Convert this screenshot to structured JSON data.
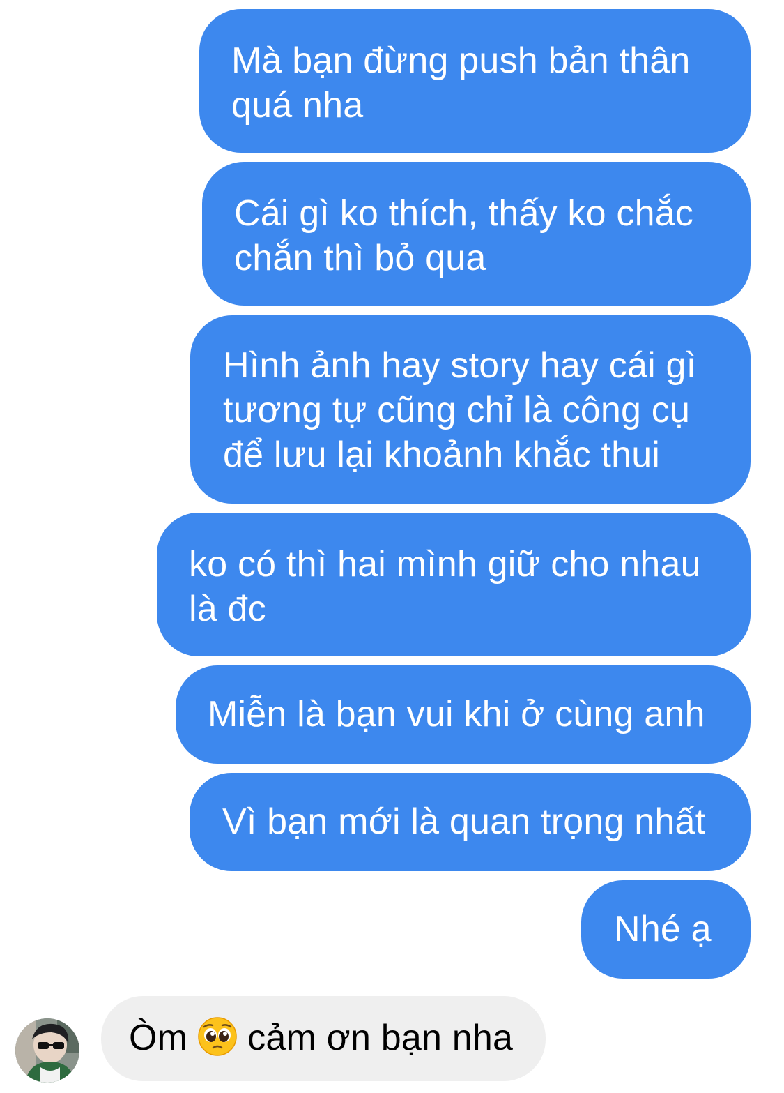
{
  "colors": {
    "outgoing_bubble": "#3d88ee",
    "incoming_bubble": "#efefef",
    "outgoing_text": "#ffffff",
    "incoming_text": "#000000"
  },
  "messages": [
    {
      "from": "me",
      "lines": [
        "Mà bạn đừng push bản thân",
        "quá nha"
      ]
    },
    {
      "from": "me",
      "lines": [
        "Cái gì ko thích, thấy ko chắc",
        "chắn thì bỏ qua"
      ]
    },
    {
      "from": "me",
      "lines": [
        "Hình ảnh hay story hay cái gì",
        "tương tự cũng chỉ là công cụ",
        "để lưu lại khoảnh khắc thui"
      ]
    },
    {
      "from": "me",
      "lines": [
        "ko có thì hai mình giữ cho nhau",
        "là đc"
      ]
    },
    {
      "from": "me",
      "lines": [
        "Miễn là bạn vui khi ở cùng anh"
      ]
    },
    {
      "from": "me",
      "lines": [
        "Vì bạn mới là quan trọng nhất"
      ]
    },
    {
      "from": "me",
      "lines": [
        "Nhé ạ"
      ]
    }
  ],
  "reply": {
    "from": "other",
    "text_before": "Òm",
    "emoji": "pleading-face-emoji",
    "text_after": "cảm ơn bạn nha",
    "avatar": "contact-avatar"
  }
}
